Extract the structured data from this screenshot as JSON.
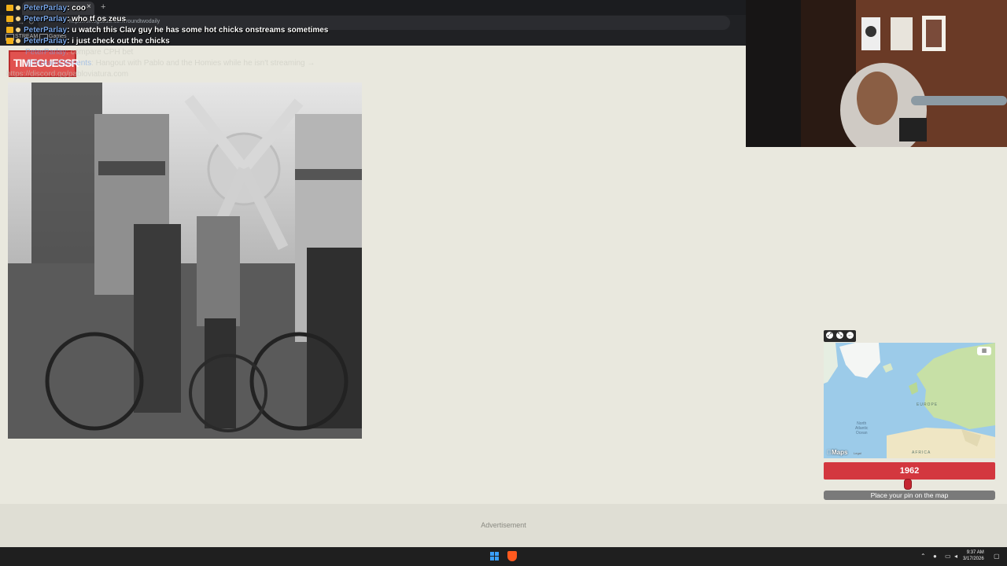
{
  "browser": {
    "tab_close": "×",
    "new_tab": "+",
    "url": "https://timeguessr.com/roundtwodaily",
    "bookmarks": [
      "STREAM",
      "Games"
    ]
  },
  "chat": [
    {
      "user": "PeterParlay",
      "message": ": coo"
    },
    {
      "user": "PeterParlay",
      "message": ": who tf os zeus"
    },
    {
      "user": "PeterParlay",
      "message": ": u watch this Clav guy he has some hot chicks onstreams sometimes"
    },
    {
      "user": "PeterParlay",
      "message": ": i just check out the chicks"
    }
  ],
  "faded_chat": [
    {
      "user": "PeterParlay",
      "message": ": compare CPH bet"
    },
    {
      "user": "@StreamElements",
      "message": ": Hangout with Pablo and the Homies while he isn't streaming →"
    },
    {
      "user": "",
      "message": "https://discord.gg/pabloviatura.com"
    }
  ],
  "overlay_logo": "TIMEGUESSR",
  "map": {
    "labels": {
      "europe": "EUROPE",
      "ocean": "North\nAtlantic\nOcean",
      "africa": "AFRICA"
    },
    "brand": "Maps",
    "legal": "Legal",
    "tool_icons": [
      "expand-icon",
      "shrink-icon",
      "pin-back-icon"
    ]
  },
  "year": "1962",
  "year_value": 1962,
  "pin_button": "Place your pin on the map",
  "advertisement": "Advertisement",
  "taskbar": {
    "time": "9:37 AM",
    "date": "3/17/2026"
  },
  "colors": {
    "page_bg": "#e9e8de",
    "year_bar": "#d3373f",
    "pin_button": "#7a7a7a",
    "chat_user": "#7aa7e8",
    "badge": "#f2b019"
  }
}
